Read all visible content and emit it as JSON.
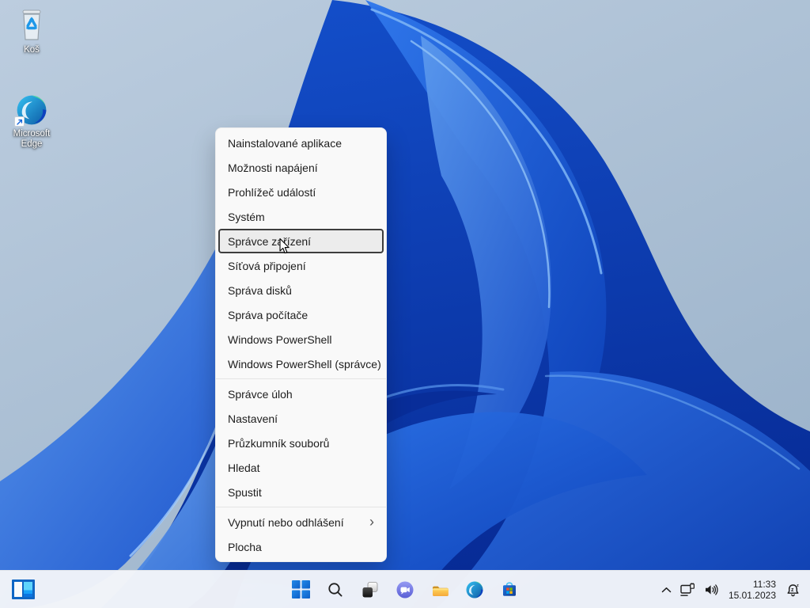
{
  "desktop": {
    "icons": [
      {
        "name": "recycle-bin",
        "label": "Koš"
      },
      {
        "name": "microsoft-edge-shortcut",
        "label": "Microsoft Edge"
      }
    ]
  },
  "context_menu": {
    "items": [
      {
        "label": "Nainstalované aplikace"
      },
      {
        "label": "Možnosti napájení"
      },
      {
        "label": "Prohlížeč událostí"
      },
      {
        "label": "Systém"
      },
      {
        "label": "Správce zařízení",
        "focused": true
      },
      {
        "label": "Síťová připojení"
      },
      {
        "label": "Správa disků"
      },
      {
        "label": "Správa počítače"
      },
      {
        "label": "Windows PowerShell"
      },
      {
        "label": "Windows PowerShell (správce)"
      },
      {
        "type": "separator"
      },
      {
        "label": "Správce úloh"
      },
      {
        "label": "Nastavení"
      },
      {
        "label": "Průzkumník souborů"
      },
      {
        "label": "Hledat"
      },
      {
        "label": "Spustit"
      },
      {
        "type": "separator"
      },
      {
        "label": "Vypnutí nebo odhlášení",
        "submenu": true
      },
      {
        "label": "Plocha"
      }
    ]
  },
  "taskbar": {
    "corner_icon": "split-window",
    "buttons": [
      "start",
      "search",
      "task-view",
      "chat",
      "file-explorer",
      "microsoft-edge",
      "microsoft-store"
    ],
    "tray": {
      "hidden_icons": "chevron-up",
      "network": "ethernet",
      "volume": "speaker",
      "time": "11:33",
      "date": "15.01.2023",
      "notifications": "bell-do-not-disturb"
    }
  },
  "colors": {
    "accent_blue": "#0f6cbd",
    "menu_bg": "#f9f9f9",
    "menu_focus_border": "#3e3e3e",
    "taskbar_bg": "#f3f5f9",
    "wallpaper_sky": "#aec3d8",
    "wallpaper_bloom_dark": "#072b96",
    "wallpaper_bloom_light": "#5d9bee"
  }
}
